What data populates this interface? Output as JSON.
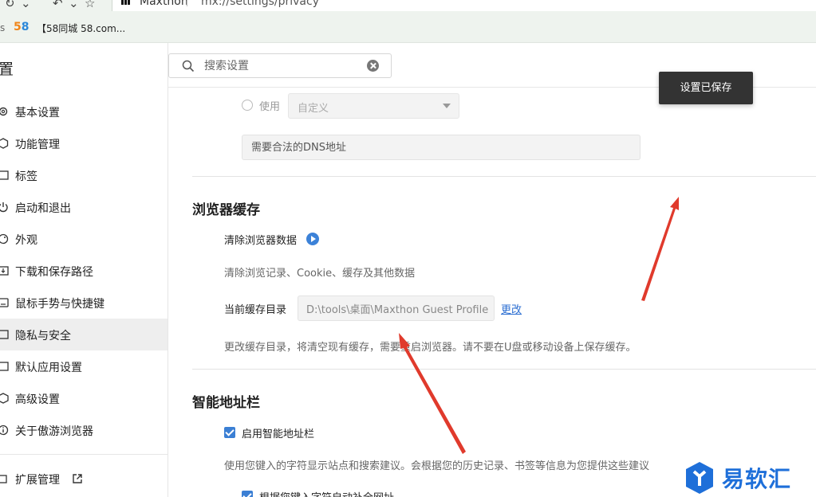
{
  "browser": {
    "site_name": "Maxthon",
    "url": "mx://settings/privacy"
  },
  "bookmarks": {
    "first_fragment": "s",
    "logo_text_a": "5",
    "logo_text_b": "8",
    "item_label": "【58同城 58.com..."
  },
  "sidebar": {
    "title_fragment": "置",
    "items": [
      {
        "label": "基本设置",
        "icon": "gear-icon"
      },
      {
        "label": "功能管理",
        "icon": "cube-icon"
      },
      {
        "label": "标签",
        "icon": "tab-icon"
      },
      {
        "label": "启动和退出",
        "icon": "power-icon"
      },
      {
        "label": "外观",
        "icon": "palette-icon"
      },
      {
        "label": "下载和保存路径",
        "icon": "download-icon"
      },
      {
        "label": "鼠标手势与快捷键",
        "icon": "mouse-icon"
      },
      {
        "label": "隐私与安全",
        "icon": "shield-icon"
      },
      {
        "label": "默认应用设置",
        "icon": "app-icon"
      },
      {
        "label": "高级设置",
        "icon": "advanced-icon"
      },
      {
        "label": "关于傲游浏览器",
        "icon": "info-icon"
      }
    ],
    "extensions_label": "扩展管理"
  },
  "search": {
    "placeholder": "搜索设置"
  },
  "toast": {
    "message": "设置已保存"
  },
  "dns": {
    "radio_label": "使用",
    "select_value": "自定义",
    "input_placeholder": "需要合法的DNS地址"
  },
  "cache_section": {
    "title": "浏览器缓存",
    "clear_title": "清除浏览器数据",
    "clear_desc": "清除浏览记录、Cookie、缓存及其他数据",
    "dir_label": "当前缓存目录",
    "dir_value": "D:\\tools\\桌面\\Maxthon Guest Profile",
    "change_link": "更改",
    "change_desc": "更改缓存目录，将清空现有缓存，需要重启浏览器。请不要在U盘或移动设备上保存缓存。"
  },
  "smart_bar": {
    "title": "智能地址栏",
    "enable_label": "启用智能地址栏",
    "enable_checked": true,
    "desc": "使用您键入的字符显示站点和搜索建议。会根据您的历史记录、书签等信息为您提供这些建议",
    "autocomplete_label": "根据您键入字符自动补全网址",
    "autocomplete_checked": true
  },
  "watermark": {
    "text": "易软汇"
  },
  "colors": {
    "accent": "#3b7fd4",
    "link": "#2d6fd2",
    "toast_bg": "#333333",
    "arrow": "#e03a2c"
  }
}
